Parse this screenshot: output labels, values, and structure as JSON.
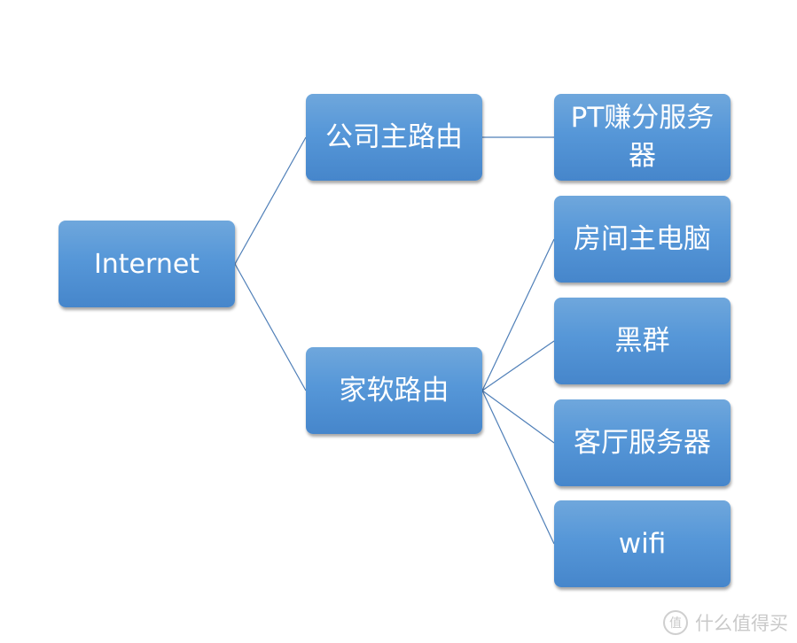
{
  "diagram": {
    "type": "tree",
    "connector_color": "#4f7fb8",
    "node_color": "#5b9bd5",
    "nodes": {
      "internet": "Internet",
      "company_router": "公司主路由",
      "home_router": "家软路由",
      "pt_server": "PT赚分服务器",
      "room_pc": "房间主电脑",
      "nas": "黑群",
      "living_server": "客厅服务器",
      "wifi": "wifi"
    },
    "edges": [
      [
        "internet",
        "company_router"
      ],
      [
        "internet",
        "home_router"
      ],
      [
        "company_router",
        "pt_server"
      ],
      [
        "home_router",
        "room_pc"
      ],
      [
        "home_router",
        "nas"
      ],
      [
        "home_router",
        "living_server"
      ],
      [
        "home_router",
        "wifi"
      ]
    ]
  },
  "watermark": {
    "icon_glyph": "值",
    "text": "什么值得买"
  }
}
